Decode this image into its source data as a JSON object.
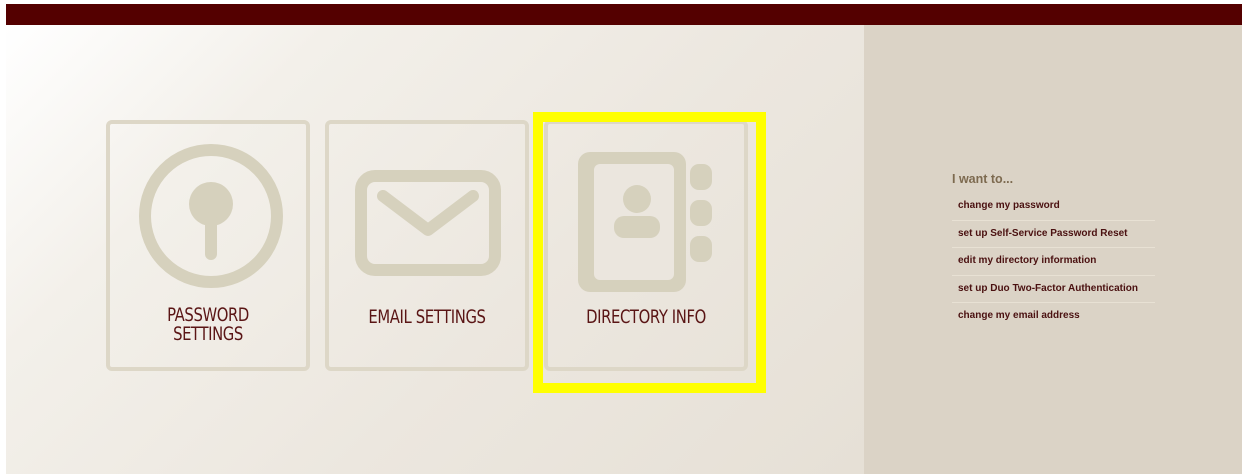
{
  "tiles": [
    {
      "label_line1": "PASSWORD",
      "label_line2": "SETTINGS",
      "icon": "keyhole-icon"
    },
    {
      "label": "EMAIL SETTINGS",
      "icon": "envelope-icon"
    },
    {
      "label": "DIRECTORY INFO",
      "icon": "address-book-icon"
    }
  ],
  "sidebar": {
    "heading": "I want to...",
    "links": [
      "change my password",
      "set up Self-Service Password Reset",
      "edit my directory information",
      "set up Duo Two-Factor Authentication",
      "change my email address"
    ]
  },
  "colors": {
    "top_bar": "#540000",
    "tile_border": "#ddd7c7",
    "icon": "#d6d1bd",
    "label_text": "#5a1515",
    "sidebar_bg": "#dbd3c6",
    "highlight": "#ffff00"
  }
}
